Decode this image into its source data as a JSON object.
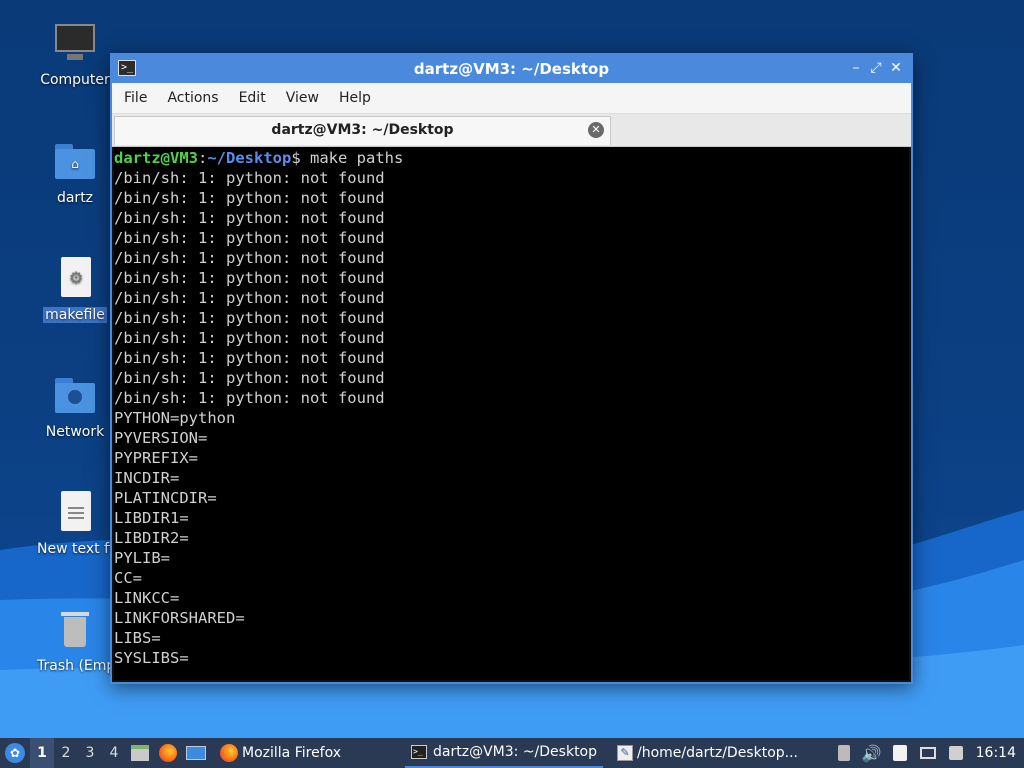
{
  "desktop": {
    "icons": [
      {
        "label": "Computer"
      },
      {
        "label": "dartz"
      },
      {
        "label": "makefile"
      },
      {
        "label": "Network"
      },
      {
        "label": "New text fil"
      },
      {
        "label": "Trash (Empt"
      }
    ]
  },
  "window": {
    "title": "dartz@VM3: ~/Desktop",
    "menu": [
      "File",
      "Actions",
      "Edit",
      "View",
      "Help"
    ],
    "tab_title": "dartz@VM3: ~/Desktop",
    "prompt": {
      "user_host": "dartz@VM3",
      "colon": ":",
      "path": "~/Desktop",
      "symbol": "$",
      "command": " make paths"
    },
    "output": [
      "/bin/sh: 1: python: not found",
      "/bin/sh: 1: python: not found",
      "/bin/sh: 1: python: not found",
      "/bin/sh: 1: python: not found",
      "/bin/sh: 1: python: not found",
      "/bin/sh: 1: python: not found",
      "/bin/sh: 1: python: not found",
      "/bin/sh: 1: python: not found",
      "/bin/sh: 1: python: not found",
      "/bin/sh: 1: python: not found",
      "/bin/sh: 1: python: not found",
      "/bin/sh: 1: python: not found",
      "PYTHON=python",
      "PYVERSION=",
      "PYPREFIX=",
      "INCDIR=",
      "PLATINCDIR=",
      "LIBDIR1=",
      "LIBDIR2=",
      "PYLIB=",
      "CC=",
      "LINKCC=",
      "LINKFORSHARED=",
      "LIBS=",
      "SYSLIBS="
    ]
  },
  "taskbar": {
    "workspaces": [
      "1",
      "2",
      "3",
      "4"
    ],
    "tasks": [
      {
        "label": "Mozilla Firefox"
      },
      {
        "label": "dartz@VM3: ~/Desktop"
      },
      {
        "label": "/home/dartz/Desktop..."
      }
    ],
    "clock": "16:14"
  },
  "colors": {
    "accent": "#4a89dc",
    "prompt_user": "#4fd34a",
    "prompt_path": "#5b8cf0",
    "taskbar": "#2a3a55"
  }
}
